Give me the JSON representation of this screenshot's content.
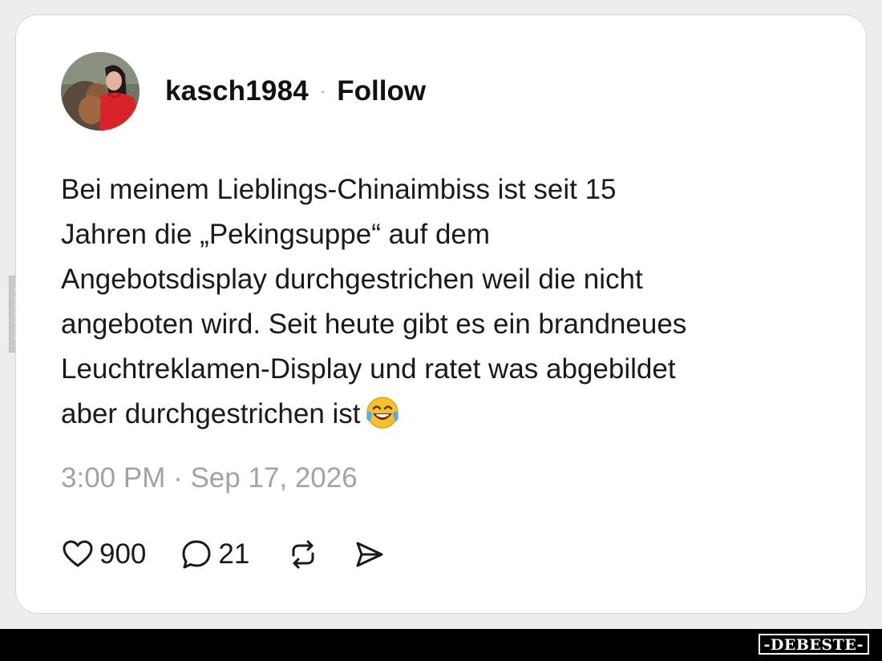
{
  "post": {
    "username": "kasch1984",
    "separator": "·",
    "follow_label": "Follow",
    "text": "Bei meinem Lieblings-Chinaimbiss ist seit 15\nJahren die „Pekingsuppe“ auf dem\nAngebotsdisplay durchgestrichen weil die nicht\nangeboten wird. Seit heute gibt es ein brandneues\nLeuchtreklamen-Display und ratet was abgebildet\naber durchgestrichen ist",
    "text_emoji": "face-with-tears-of-joy",
    "timestamp": "3:00 PM · Sep 17, 2026",
    "likes": "900",
    "replies": "21"
  },
  "icons": {
    "like": "heart-icon",
    "reply": "speech-bubble-icon",
    "repost": "repost-icon",
    "share": "send-icon"
  },
  "watermark": {
    "brand": "-DEBESTE-",
    "side": "DEBESTE"
  },
  "colors": {
    "text": "#1a1a1a",
    "muted": "#a3a3a3",
    "card": "#ffffff",
    "background": "#ededed",
    "bar": "#000000"
  }
}
